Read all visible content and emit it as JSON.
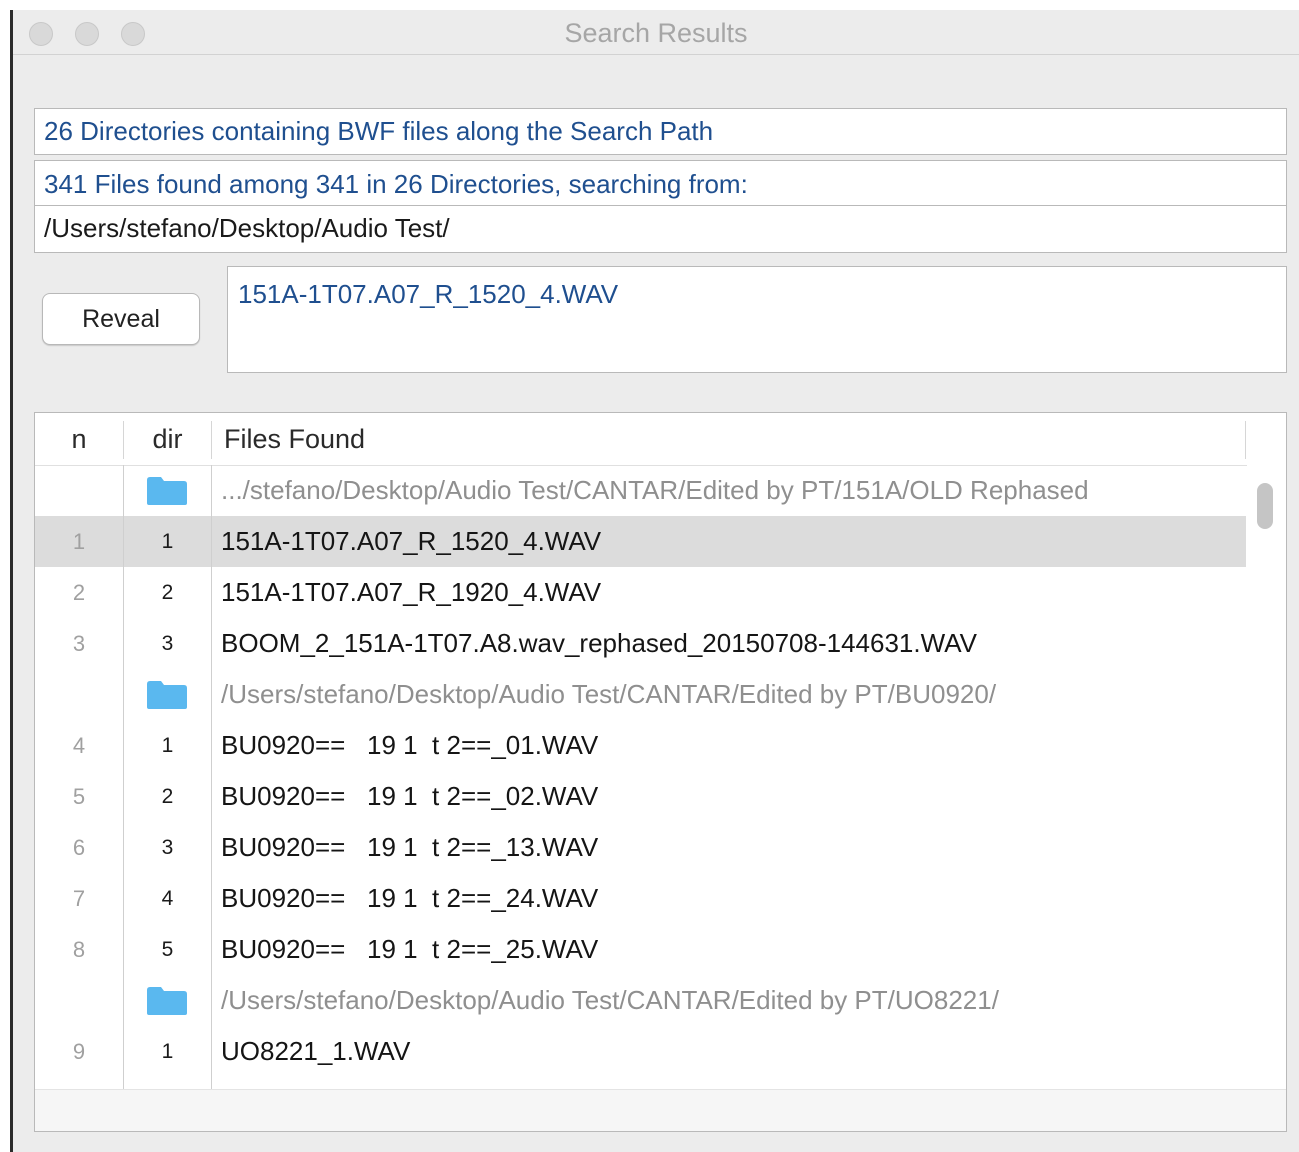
{
  "window": {
    "title": "Search Results"
  },
  "summary": {
    "directories_line": "26 Directories containing BWF files along the Search Path",
    "files_line": "341 Files found among 341 in 26 Directories, searching from:",
    "search_path": "/Users/stefano/Desktop/Audio Test/"
  },
  "actions": {
    "reveal_label": "Reveal"
  },
  "selected_file": "151A-1T07.A07_R_1520_4.WAV",
  "table": {
    "headers": {
      "n": "n",
      "dir": "dir",
      "files": "Files Found"
    },
    "rows": [
      {
        "type": "dir",
        "n": "",
        "dir": "",
        "file": ".../stefano/Desktop/Audio Test/CANTAR/Edited by PT/151A/OLD Rephased"
      },
      {
        "type": "file",
        "n": "1",
        "dir": "1",
        "file": "151A-1T07.A07_R_1520_4.WAV",
        "selected": true
      },
      {
        "type": "file",
        "n": "2",
        "dir": "2",
        "file": "151A-1T07.A07_R_1920_4.WAV"
      },
      {
        "type": "file",
        "n": "3",
        "dir": "3",
        "file": "BOOM_2_151A-1T07.A8.wav_rephased_20150708-144631.WAV"
      },
      {
        "type": "dir",
        "n": "",
        "dir": "",
        "file": "/Users/stefano/Desktop/Audio Test/CANTAR/Edited by PT/BU0920/"
      },
      {
        "type": "file",
        "n": "4",
        "dir": "1",
        "file": "BU0920==   19 1  t 2==_01.WAV"
      },
      {
        "type": "file",
        "n": "5",
        "dir": "2",
        "file": "BU0920==   19 1  t 2==_02.WAV"
      },
      {
        "type": "file",
        "n": "6",
        "dir": "3",
        "file": "BU0920==   19 1  t 2==_13.WAV"
      },
      {
        "type": "file",
        "n": "7",
        "dir": "4",
        "file": "BU0920==   19 1  t 2==_24.WAV"
      },
      {
        "type": "file",
        "n": "8",
        "dir": "5",
        "file": "BU0920==   19 1  t 2==_25.WAV"
      },
      {
        "type": "dir",
        "n": "",
        "dir": "",
        "file": "/Users/stefano/Desktop/Audio Test/CANTAR/Edited by PT/UO8221/"
      },
      {
        "type": "file",
        "n": "9",
        "dir": "1",
        "file": "UO8221_1.WAV"
      }
    ]
  },
  "colors": {
    "folder_icon": "#5ab8ef",
    "link_text": "#1f4f8f",
    "selected_row": "#dcdcdc"
  }
}
